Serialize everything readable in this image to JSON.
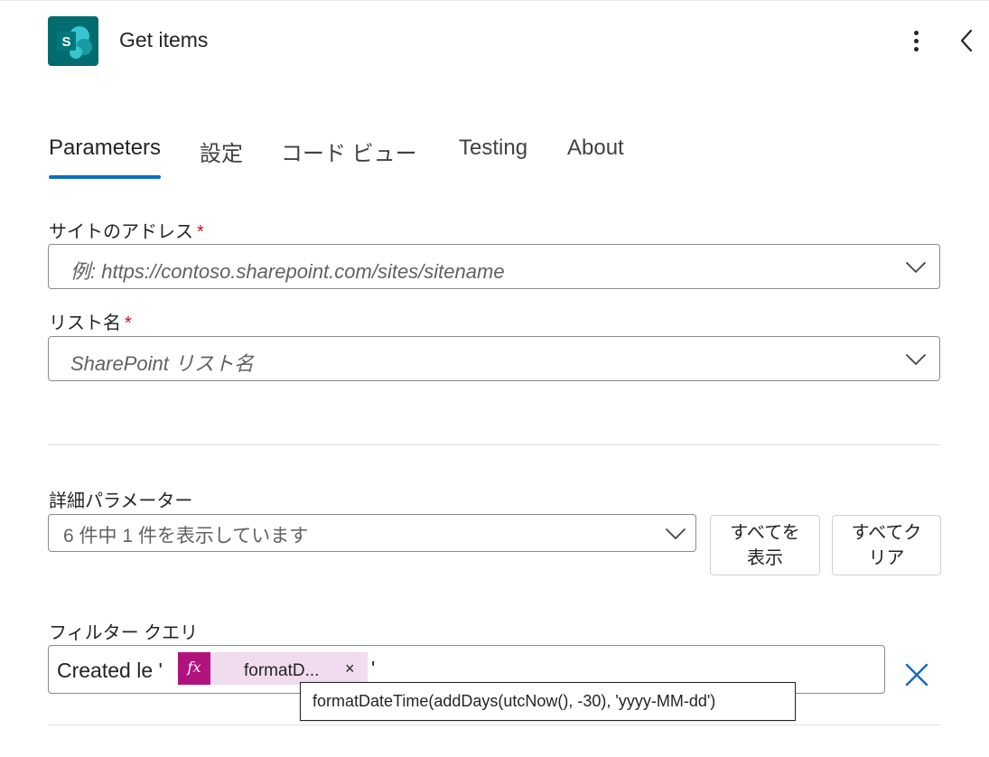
{
  "header": {
    "title": "Get items",
    "logo_letter": "S",
    "brand_color": "#036c70"
  },
  "tabs": [
    {
      "label": "Parameters",
      "active": true
    },
    {
      "label": "設定",
      "active": false
    },
    {
      "label": "コード ビュー",
      "active": false
    },
    {
      "label": "Testing",
      "active": false
    },
    {
      "label": "About",
      "active": false
    }
  ],
  "accent_color": "#0f6cbd",
  "site_address": {
    "label": "サイトのアドレス",
    "required_mark": "*",
    "placeholder": "例: https://contoso.sharepoint.com/sites/sitename"
  },
  "list_name": {
    "label": "リスト名",
    "required_mark": "*",
    "placeholder": "SharePoint リスト名"
  },
  "advanced": {
    "label": "詳細パラメーター",
    "value": "6 件中 1 件を表示しています",
    "show_all_line1": "すべてを",
    "show_all_line2": "表示",
    "clear_all_line1": "すべてク",
    "clear_all_line2": "リア"
  },
  "filter": {
    "label": "フィルター クエリ",
    "text_prefix": "Created le '",
    "token_icon": "fx",
    "token_label": "formatD...",
    "token_remove": "×",
    "text_suffix": "'",
    "token_color": "#b1137e",
    "tooltip": "formatDateTime(addDays(utcNow(), -30), 'yyyy-MM-dd')"
  },
  "icons": {
    "more": "more-vertical-icon",
    "collapse": "chevron-left-icon",
    "dropdown": "chevron-down-icon",
    "clear": "dismiss-icon"
  }
}
